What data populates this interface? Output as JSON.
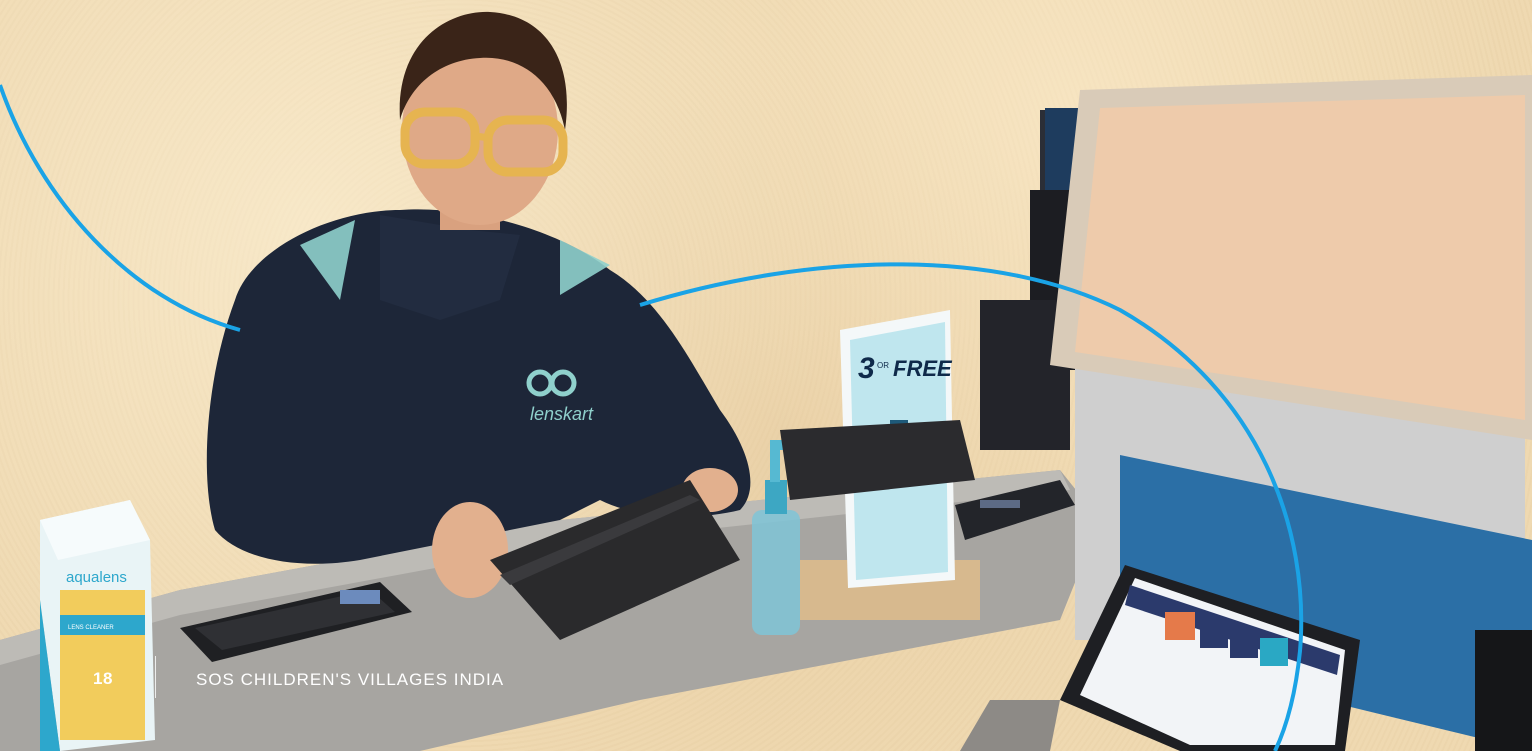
{
  "page": {
    "number": "18",
    "running_title": "SOS CHILDREN'S VILLAGES INDIA"
  },
  "photo": {
    "logo_text": "lenskart",
    "sign_text": "3",
    "sign_small": "OR",
    "sign_free": "FREE",
    "box_brand": "aqualens",
    "box_label": "LENS CLEANER"
  },
  "colors": {
    "accent_curve": "#1aa3e6",
    "paper": "#efd9b1",
    "uniform": "#1d2638",
    "counter": "#9c9a96"
  }
}
